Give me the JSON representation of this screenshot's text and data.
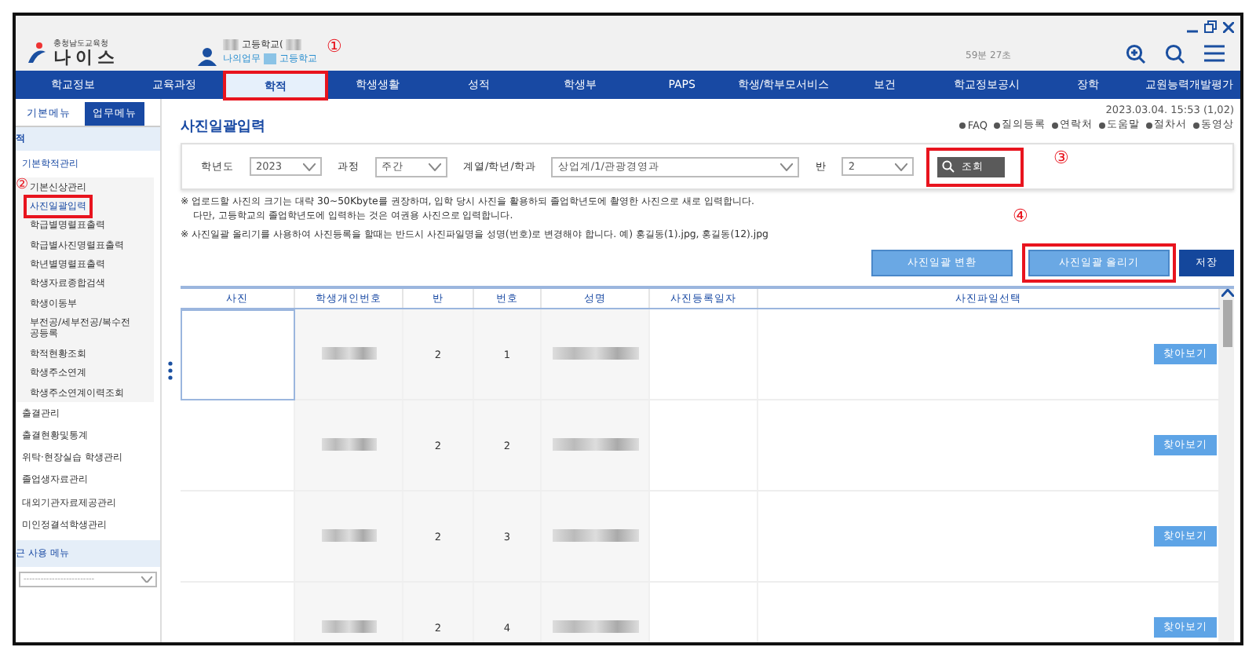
{
  "header": {
    "org": "충청남도교육청",
    "logo": "나이스",
    "user_school": "고등학교(",
    "user_links": [
      "나의업무",
      "고등학교"
    ],
    "timer": "59분 27초"
  },
  "nav": [
    {
      "label": "학교정보",
      "selected": false,
      "highlighted": false
    },
    {
      "label": "교육과정",
      "selected": false,
      "highlighted": false
    },
    {
      "label": "학적",
      "selected": true,
      "highlighted": true,
      "mark": "①"
    },
    {
      "label": "학생생활",
      "selected": false,
      "highlighted": false
    },
    {
      "label": "성적",
      "selected": false,
      "highlighted": false
    },
    {
      "label": "학생부",
      "selected": false,
      "highlighted": false
    },
    {
      "label": "PAPS",
      "selected": false,
      "highlighted": false
    },
    {
      "label": "학생/학부모서비스",
      "selected": false,
      "highlighted": false
    },
    {
      "label": "보건",
      "selected": false,
      "highlighted": false
    },
    {
      "label": "학교정보공시",
      "selected": false,
      "highlighted": false
    },
    {
      "label": "장학",
      "selected": false,
      "highlighted": false
    },
    {
      "label": "교원능력개발평가",
      "selected": false,
      "highlighted": false
    }
  ],
  "sidebar": {
    "tabs": [
      {
        "label": "기본메뉴",
        "selected": false
      },
      {
        "label": "업무메뉴",
        "selected": true
      }
    ],
    "section": "적",
    "group": "기본학적관리",
    "sub_items": [
      {
        "label": "기본신상관리",
        "selected": false,
        "highlighted": false,
        "mark": "②"
      },
      {
        "label": "사진일괄입력",
        "selected": true,
        "highlighted": true
      },
      {
        "label": "학급별명렬표출력",
        "selected": false,
        "highlighted": false
      },
      {
        "label": "학급별사진명렬표출력",
        "selected": false,
        "highlighted": false
      },
      {
        "label": "학년별명렬표출력",
        "selected": false,
        "highlighted": false
      },
      {
        "label": "학생자료종합검색",
        "selected": false,
        "highlighted": false
      },
      {
        "label": "학생이동부",
        "selected": false,
        "highlighted": false
      },
      {
        "label": "부전공/세부전공/복수전공등록",
        "selected": false,
        "highlighted": false
      },
      {
        "label": "학적현황조회",
        "selected": false,
        "highlighted": false
      },
      {
        "label": "학생주소연계",
        "selected": false,
        "highlighted": false
      },
      {
        "label": "학생주소연계이력조회",
        "selected": false,
        "highlighted": false
      }
    ],
    "items": [
      "출결관리",
      "출결현황및통계",
      "위탁·현장실습 학생관리",
      "졸업생자료관리",
      "대외기관자료제공관리",
      "미인정결석학생관리"
    ],
    "recent_title": "근 사용 메뉴",
    "recent_select": "-------------------------"
  },
  "page": {
    "title": "사진일괄입력",
    "timestamp": "2023.03.04. 15:53 (1,02)",
    "links": [
      "FAQ",
      "질의등록",
      "연락처",
      "도움말",
      "절차서",
      "동영상"
    ],
    "filters": [
      {
        "label": "학년도",
        "value": "2023"
      },
      {
        "label": "과정",
        "value": "주간"
      },
      {
        "label": "계열/학년/학과",
        "value": "상업계/1/관광경영과"
      },
      {
        "label": "반",
        "value": "2"
      }
    ],
    "search_button": {
      "label": "조회",
      "highlighted": true,
      "mark": "③"
    },
    "notes": [
      "※ 업로드할 사진의 크기는 대략 30~50Kbyte를 권장하며, 입학 당시 사진을 활용하되 졸업학년도에 촬영한 사진으로 새로 입력합니다.",
      "다만, 고등학교의 졸업학년도에 입력하는 것은 여권용 사진으로 입력합니다.",
      "※ 사진일괄 올리기를 사용하여 사진등록을 할때는 반드시 사진파일명을 성명(번호)로 변경해야 합니다.  예) 홍길동(1).jpg, 홍길동(12).jpg"
    ],
    "buttons": [
      {
        "label": "사진일괄 변환",
        "kind": "light",
        "highlighted": false
      },
      {
        "label": "사진일괄 올리기",
        "kind": "light",
        "highlighted": true,
        "mark": "④"
      },
      {
        "label": "저장",
        "kind": "dark",
        "highlighted": false
      }
    ]
  },
  "table": {
    "columns": [
      "사진",
      "학생개인번호",
      "반",
      "번호",
      "성명",
      "사진등록일자",
      "사진파일선택"
    ],
    "rows": [
      {
        "class": "2",
        "number": "1",
        "button": "찾아보기"
      },
      {
        "class": "2",
        "number": "2",
        "button": "찾아보기"
      },
      {
        "class": "2",
        "number": "3",
        "button": "찾아보기"
      },
      {
        "class": "2",
        "number": "4",
        "button": "찾아보기"
      }
    ]
  }
}
